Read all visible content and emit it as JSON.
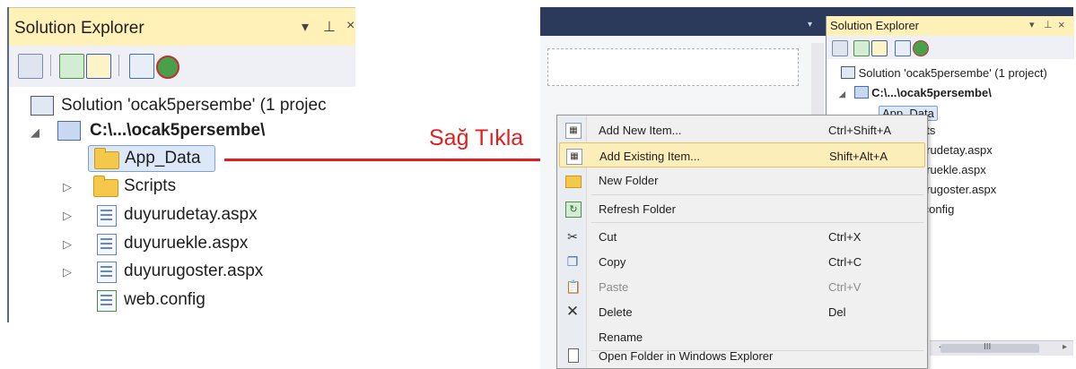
{
  "annotation": {
    "label": "Sağ Tıkla"
  },
  "left_panel": {
    "title": "Solution Explorer",
    "title_buttons": [
      "▾",
      "⊥",
      "×"
    ],
    "solution": "Solution 'ocak5persembe' (1 projec",
    "project": "C:\\...\\ocak5persembe\\",
    "items": [
      {
        "label": "App_Data",
        "icon": "folder-icon"
      },
      {
        "label": "Scripts",
        "icon": "folder-icon"
      },
      {
        "label": "duyurudetay.aspx",
        "icon": "aspx-file-icon"
      },
      {
        "label": "duyuruekle.aspx",
        "icon": "aspx-file-icon"
      },
      {
        "label": "duyurugoster.aspx",
        "icon": "aspx-file-icon"
      },
      {
        "label": "web.config",
        "icon": "config-file-icon"
      }
    ],
    "toolbar_icons": [
      "properties-icon",
      "refresh-icon",
      "show-all-files-icon",
      "view-code-icon",
      "view-designer-icon"
    ]
  },
  "right_panel": {
    "title": "Solution Explorer",
    "title_buttons": [
      "▾",
      "⊥",
      "×"
    ],
    "solution": "Solution 'ocak5persembe' (1 project)",
    "project": "C:\\...\\ocak5persembe\\",
    "items": [
      "App_Data",
      "pts",
      "urudetay.aspx",
      "uruekle.aspx",
      "urugoster.aspx",
      ".config"
    ],
    "scroll_mark": "III"
  },
  "context_menu": {
    "items": [
      {
        "label": "Add New Item...",
        "shortcut": "Ctrl+Shift+A",
        "icon": "add-new-item-icon",
        "enabled": true,
        "highlight": false
      },
      {
        "label": "Add Existing Item...",
        "shortcut": "Shift+Alt+A",
        "icon": "add-existing-item-icon",
        "enabled": true,
        "highlight": true
      },
      {
        "label": "New Folder",
        "shortcut": "",
        "icon": "new-folder-icon",
        "enabled": true,
        "highlight": false
      },
      {
        "label": "Refresh Folder",
        "shortcut": "",
        "icon": "refresh-icon",
        "enabled": true,
        "highlight": false
      },
      {
        "label": "Cut",
        "shortcut": "Ctrl+X",
        "icon": "cut-icon",
        "enabled": true,
        "highlight": false
      },
      {
        "label": "Copy",
        "shortcut": "Ctrl+C",
        "icon": "copy-icon",
        "enabled": true,
        "highlight": false
      },
      {
        "label": "Paste",
        "shortcut": "Ctrl+V",
        "icon": "paste-icon",
        "enabled": false,
        "highlight": false
      },
      {
        "label": "Delete",
        "shortcut": "Del",
        "icon": "delete-icon",
        "enabled": true,
        "highlight": false
      },
      {
        "label": "Rename",
        "shortcut": "",
        "icon": "",
        "enabled": true,
        "highlight": false
      },
      {
        "label": "Open Folder in Windows Explorer",
        "shortcut": "",
        "icon": "open-folder-icon",
        "enabled": true,
        "highlight": false
      }
    ]
  },
  "colors": {
    "accent": "#e02020",
    "title_bar": "#fff1b8",
    "highlight": "#fbeeb8",
    "vs_frame": "#2b3a5a"
  }
}
